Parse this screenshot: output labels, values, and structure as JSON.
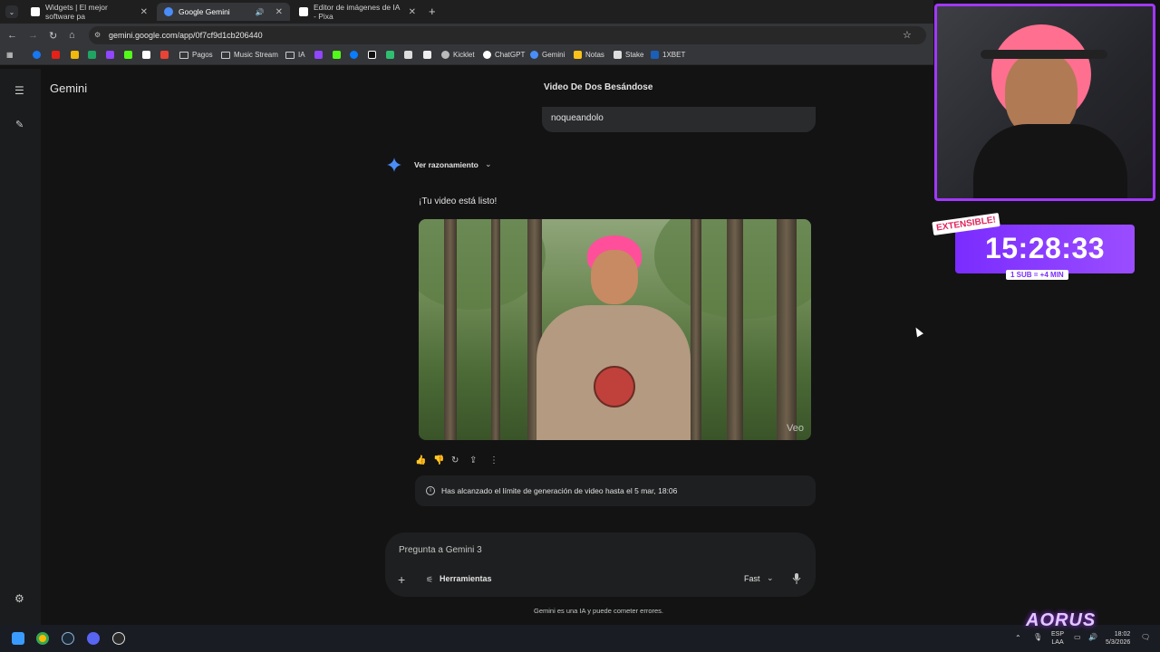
{
  "browser": {
    "tabs": [
      {
        "label": "Widgets | El mejor software pa",
        "active": false
      },
      {
        "label": "Google Gemini",
        "active": true
      },
      {
        "label": "Editor de imágenes de IA - Pixa",
        "active": false
      }
    ],
    "url": "gemini.google.com/app/0f7cf9d1cb206440",
    "bookmarks": [
      "Pagos",
      "Music Stream",
      "IA",
      "Kicklet",
      "ChatGPT",
      "Gemini",
      "Notas",
      "Stake",
      "1XBET"
    ]
  },
  "gemini": {
    "brand": "Gemini",
    "chat_title": "Video De Dos Besándose",
    "user_message": "noqueandolo",
    "reasoning_label": "Ver razonamiento",
    "response_text": "¡Tu video está listo!",
    "video_watermark": "Veo",
    "limit_notice": "Has alcanzado el límite de generación de video hasta el 5 mar, 18:06",
    "composer": {
      "placeholder": "Pregunta a Gemini 3",
      "tools_label": "Herramientas",
      "model_label": "Fast"
    },
    "disclaimer": "Gemini es una IA y puede cometer errores."
  },
  "overlay": {
    "extensible": "EXTENSIBLE!",
    "timer": "15:28:33",
    "sub_rate": "1 SUB = +4 MIN",
    "brand": "AORUS"
  },
  "taskbar": {
    "lang_top": "ESP",
    "lang_bottom": "LAA",
    "time": "18:02",
    "date": "5/3/2026"
  },
  "colors": {
    "accent": "#a238ff",
    "page_bg": "#131314",
    "bubble_bg": "#2a2b2d"
  }
}
